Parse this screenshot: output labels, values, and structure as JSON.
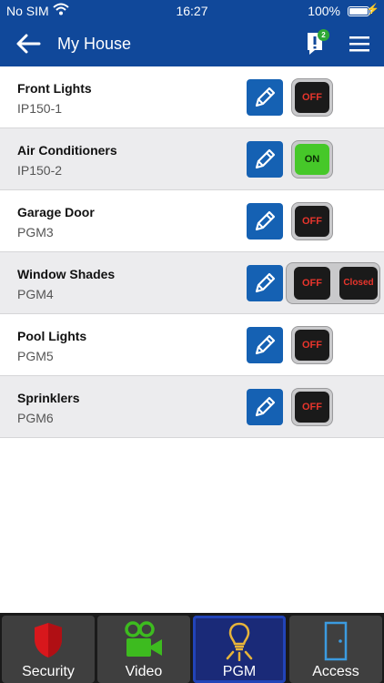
{
  "status": {
    "carrier": "No SIM",
    "time": "16:27",
    "battery": "100%"
  },
  "header": {
    "title": "My House",
    "alert_count": "2"
  },
  "rows": [
    {
      "name": "Front Lights",
      "sub": "IP150-1",
      "state": "OFF"
    },
    {
      "name": "Air Conditioners",
      "sub": "IP150-2",
      "state": "ON"
    },
    {
      "name": "Garage Door",
      "sub": "PGM3",
      "state": "OFF"
    },
    {
      "name": "Window Shades",
      "sub": "PGM4",
      "state": "OFF",
      "extra": "Closed"
    },
    {
      "name": "Pool Lights",
      "sub": "PGM5",
      "state": "OFF"
    },
    {
      "name": "Sprinklers",
      "sub": "PGM6",
      "state": "OFF"
    }
  ],
  "tabs": [
    {
      "label": "Security",
      "icon": "shield-icon"
    },
    {
      "label": "Video",
      "icon": "video-camera-icon"
    },
    {
      "label": "PGM",
      "icon": "lightbulb-icon",
      "active": true
    },
    {
      "label": "Access",
      "icon": "door-icon"
    }
  ],
  "colors": {
    "brand": "#10489a",
    "edit": "#1561b3",
    "on": "#46c829",
    "off_text": "#e8352c"
  }
}
